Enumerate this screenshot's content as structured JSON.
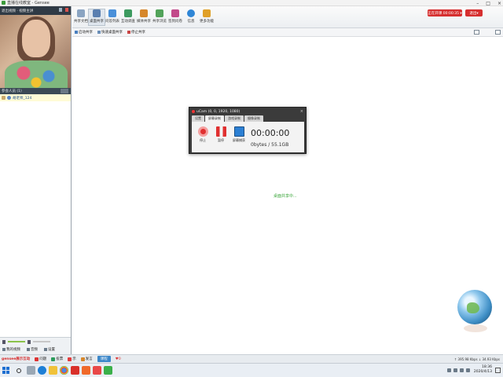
{
  "window": {
    "title": "直播在线教室 - Gensee",
    "controls": [
      "–",
      "□",
      "×"
    ]
  },
  "left_panel": {
    "video_header": "退出视频 · 视频主讲",
    "participants_header": "参会人员 (1)",
    "participant": {
      "name": "胡老师_124"
    },
    "footer": {
      "mic_label": "我的视频",
      "speaker_label": "音频",
      "settings_label": "设置"
    }
  },
  "toolbar": {
    "tools": [
      {
        "label": "共享文档",
        "icon": "document-icon",
        "color": "#8aa4c2"
      },
      {
        "label": "桌面共享",
        "icon": "desktop-share-icon",
        "color": "#5a7fb0",
        "active": true
      },
      {
        "label": "问答列表",
        "icon": "qa-list-icon",
        "color": "#4a90d9"
      },
      {
        "label": "互动调查",
        "icon": "survey-icon",
        "color": "#3c9a5f"
      },
      {
        "label": "媒体共享",
        "icon": "media-share-icon",
        "color": "#d6872b"
      },
      {
        "label": "共享浏览",
        "icon": "web-share-icon",
        "color": "#52a35a"
      },
      {
        "label": "签到问卷",
        "icon": "signin-icon",
        "color": "#c24a8a"
      },
      {
        "label": "信息",
        "icon": "info-icon",
        "color": "#2f86d6"
      },
      {
        "label": "更多功能",
        "icon": "more-features-icon",
        "color": "#e0a028"
      }
    ],
    "status_pill": "正在开课 00:00:35 ▾",
    "logout_label": "退出▾"
  },
  "sharebar": {
    "items": [
      "启动共享",
      "快速桌面共享",
      "停止共享"
    ]
  },
  "canvas": {
    "share_message": "桌面共享中..."
  },
  "ucam": {
    "title": "uCam (0, 0, 1920, 1080)",
    "close": "×",
    "tabs": [
      "设置",
      "屏幕录制",
      "游戏录制",
      "摄像录制"
    ],
    "active_tab_index": 1,
    "buttons": [
      "停止",
      "暂停",
      "屏幕捕获"
    ],
    "timer": "00:00:00",
    "size": "0bytes / 55.1GB"
  },
  "bottom_bar": {
    "brand": "gensee展示互动",
    "items": [
      "问题",
      "投票",
      "示",
      "发言"
    ],
    "main_tab": "课程",
    "heart_count": "0",
    "net_status": "↑ 395.98 Kbps  ↓ 34.93 Kbps"
  },
  "taskbar": {
    "time": "18:36",
    "date": "2020/4/13"
  }
}
